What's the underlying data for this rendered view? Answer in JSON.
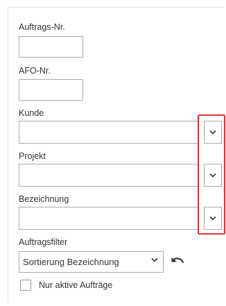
{
  "fields": {
    "auftrags_nr": {
      "label": "Auftrags-Nr.",
      "value": ""
    },
    "afo_nr": {
      "label": "AFO-Nr.",
      "value": ""
    },
    "kunde": {
      "label": "Kunde",
      "value": ""
    },
    "projekt": {
      "label": "Projekt",
      "value": ""
    },
    "bezeichnung": {
      "label": "Bezeichnung",
      "value": ""
    }
  },
  "auftragsfilter": {
    "label": "Auftragsfilter",
    "selected": "Sortierung Bezeichnung"
  },
  "nur_aktive": {
    "label": "Nur aktive Aufträge",
    "checked": false
  },
  "icons": {
    "dropdown": "chevron-down-icon",
    "reset": "undo-icon"
  },
  "colors": {
    "highlight": "#e03333",
    "border": "#aaaaaa"
  }
}
